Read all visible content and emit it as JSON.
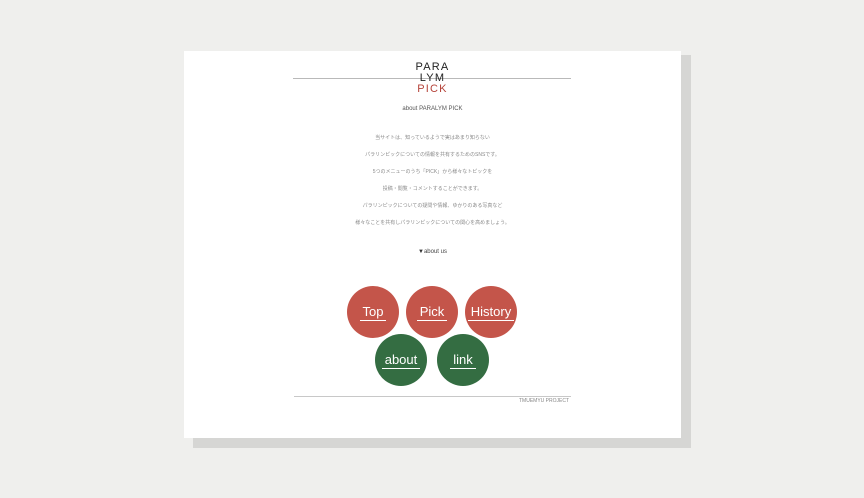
{
  "logo": {
    "line1": "PARA",
    "line2": "LYM",
    "line3": "PICK"
  },
  "subtitle": "about PARALYM PICK",
  "description": [
    "当サイトは、知っているようで実はあまり知らない",
    "パラリンピックについての情報を共有するためのSNSです。",
    "5つのメニューのうち「PICK」から様々なトピックを",
    "投稿・閲覧・コメントすることができます。",
    "パラリンピックについての疑問や情報、ゆかりのある写真など",
    "様々なことを共有しパラリンピックについての関心を高めましょう。"
  ],
  "about_link": {
    "triangle": "▼",
    "label": "about us"
  },
  "nav": {
    "top": "Top",
    "pick": "Pick",
    "history": "History",
    "about": "about",
    "link": "link"
  },
  "footer": "TMUEMYU PROJECT",
  "colors": {
    "red": "#c4554a",
    "green": "#346d42",
    "logo_accent": "#b5433a"
  }
}
